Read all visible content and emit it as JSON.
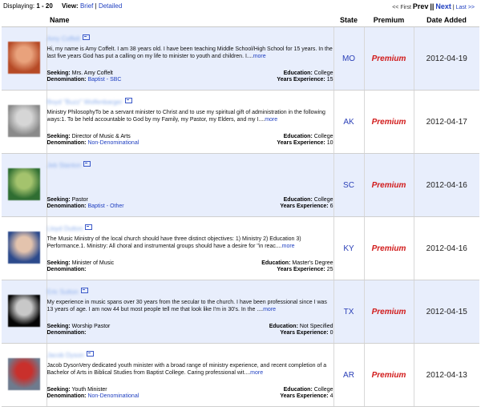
{
  "topbar": {
    "displaying_label": "Displaying:",
    "range": "1 - 20",
    "view_label": "View:",
    "brief": "Brief",
    "separator": "|",
    "detailed": "Detailed",
    "first": "<< First",
    "prev": "Prev",
    "pipes": "||",
    "next": "Next",
    "last": "Last >>"
  },
  "table": {
    "headers": {
      "name": "Name",
      "state": "State",
      "premium": "Premium",
      "date": "Date Added"
    }
  },
  "labels": {
    "seeking": "Seeking:",
    "denomination": "Denomination:",
    "education": "Education:",
    "years": "Years Experience:",
    "more": "more"
  },
  "rows": [
    {
      "name": "Amy Coffelt",
      "description": "Hi, my name is Amy Coffelt. I am 38 years old. I have been teaching Middle School/High School for 15 years. In the last five years God has put a calling on my life to minister to youth and children. I....",
      "seeking": "Mrs. Amy Coffelt",
      "denomination": "Baptist - SBC",
      "education": "College",
      "years": "15",
      "state": "MO",
      "premium": "Premium",
      "date": "2012-04-19",
      "avatar_colors": [
        "#b64a26",
        "#e9a27c"
      ]
    },
    {
      "name": "Boyd \"Buzz\" Wolfenbarger",
      "description": "Ministry PhilosophyTo be a servant minister to Christ and to use my spiritual gift of administration in the following ways:1. To be held accountable to God by my Family, my Pastor, my Elders, and my I....",
      "seeking": "Director of Music & Arts",
      "denomination": "Non-Denominational",
      "education": "College",
      "years": "10",
      "state": "AK",
      "premium": "Premium",
      "date": "2012-04-17",
      "avatar_colors": [
        "#8a8a8a",
        "#d6d6d6"
      ]
    },
    {
      "name": "Jeb Stanton",
      "description": "",
      "seeking": "Pastor",
      "denomination": "Baptist - Other",
      "education": "College",
      "years": "6",
      "state": "SC",
      "premium": "Premium",
      "date": "2012-04-16",
      "avatar_colors": [
        "#2f6e32",
        "#a4c36d"
      ]
    },
    {
      "name": "Lloyd Dutton",
      "description": "The Music Ministry of the local church should have three distinct objectives: 1) Ministry 2) Education 3) Performance.1. Ministry: All choral and instrumental groups should have a desire for \"in reac....",
      "seeking": "Minister of Music",
      "denomination": "",
      "education": "Master's Degree",
      "years": "25",
      "state": "KY",
      "premium": "Premium",
      "date": "2012-04-16",
      "avatar_colors": [
        "#2c4a8c",
        "#e3c3ad"
      ]
    },
    {
      "name": "Eric Sutton",
      "description": "My experience in music spans over 30 years from the secular to the church. I have been professional since I was 13 years of age. I am now 44 but most people tell me that look like I'm in 30's. In the ....",
      "seeking": "Worship Pastor",
      "denomination": "",
      "education": "Not Specified",
      "years": "0",
      "state": "TX",
      "premium": "Premium",
      "date": "2012-04-15",
      "avatar_colors": [
        "#050505",
        "#c8c8c8"
      ]
    },
    {
      "name": "Jacob Dyson",
      "description": "Jacob DysonVery dedicated youth minister with a broad range of ministry experience, and recent completion of a Bachelor of Arts in Biblical Studies from Baptist College. Caring professional wit....",
      "seeking": "Youth Minister",
      "denomination": "Non-Denominational",
      "education": "College",
      "years": "4",
      "state": "AR",
      "premium": "Premium",
      "date": "2012-04-13",
      "avatar_colors": [
        "#6e7b8e",
        "#c9302c"
      ]
    }
  ]
}
